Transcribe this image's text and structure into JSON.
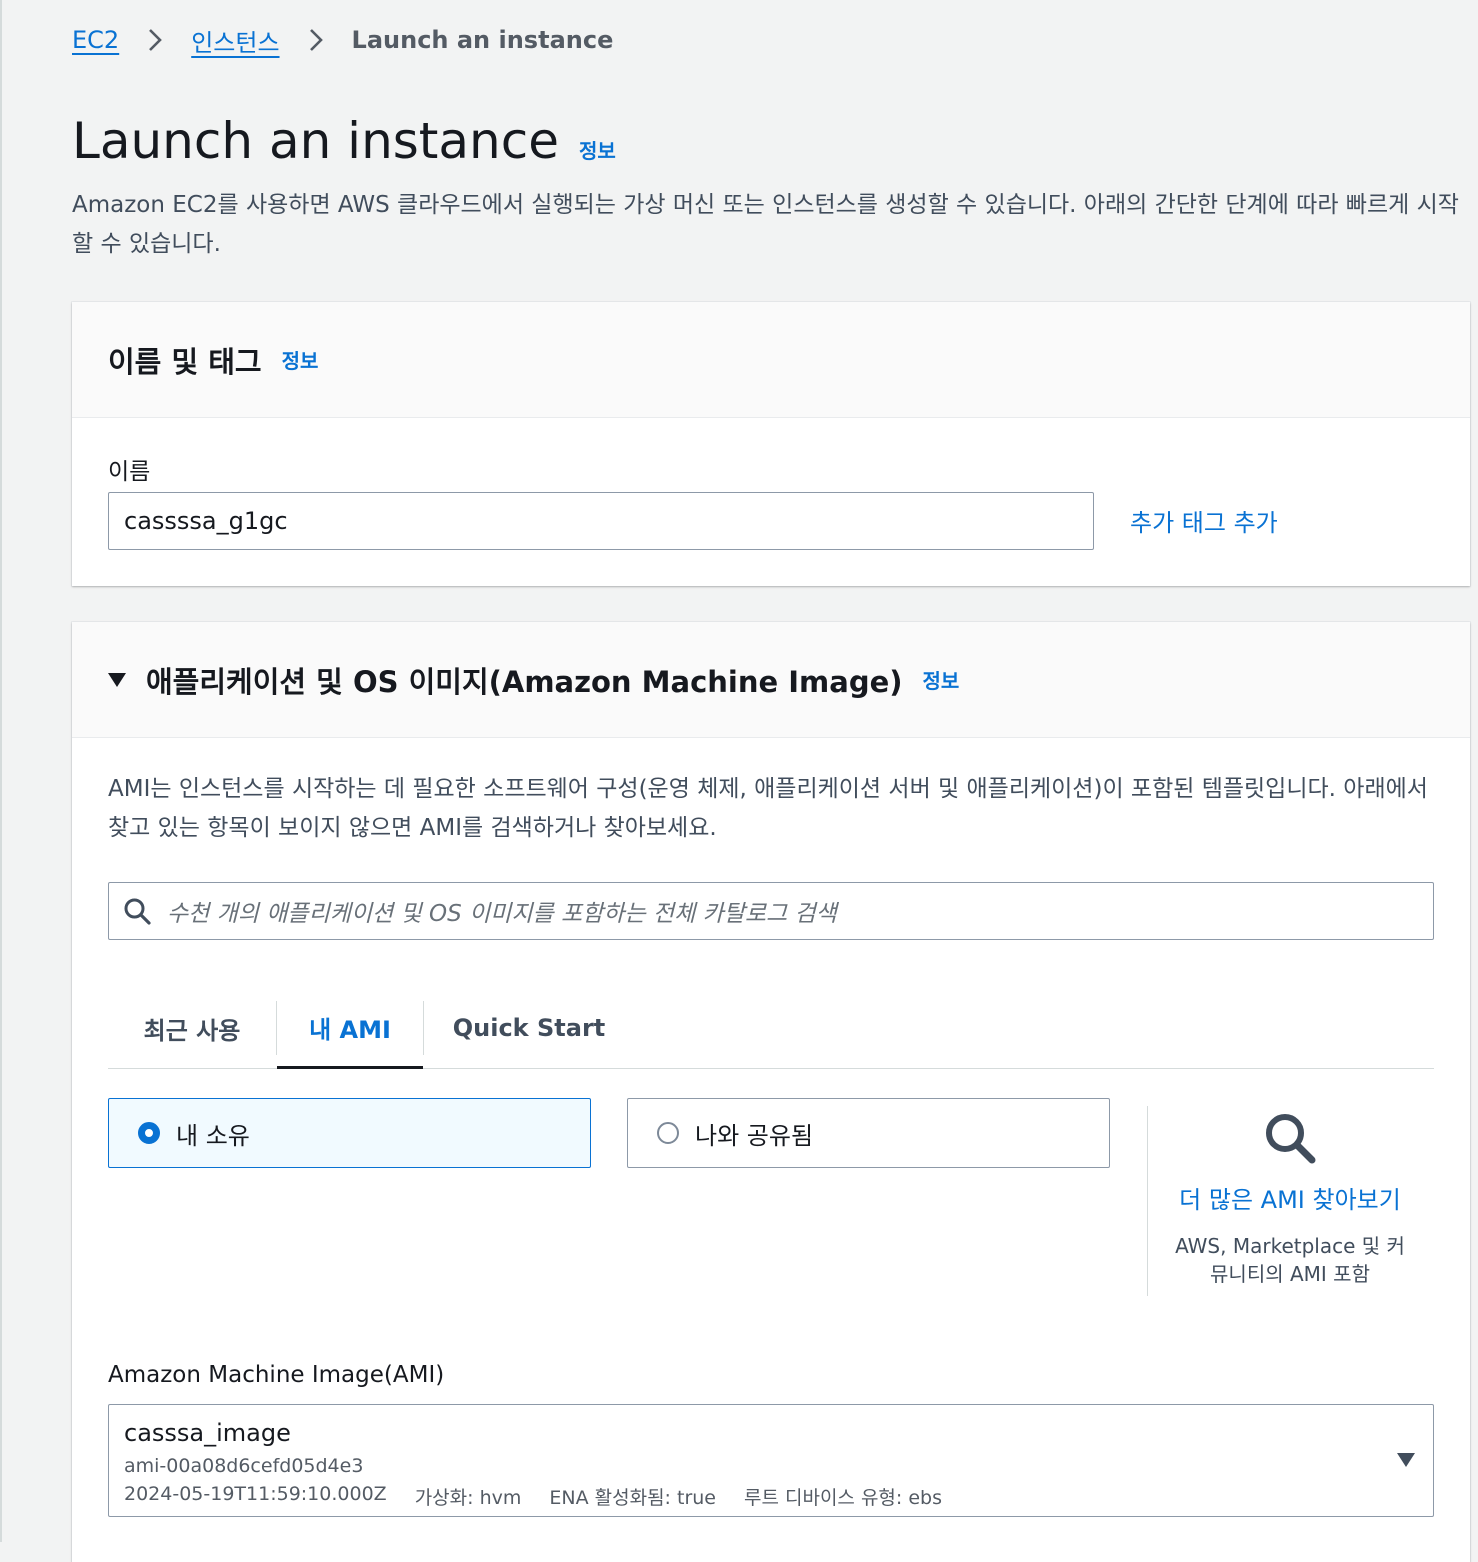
{
  "breadcrumb": {
    "items": [
      "EC2",
      "인스턴스"
    ],
    "current": "Launch an instance"
  },
  "page": {
    "title": "Launch an instance",
    "info": "정보",
    "description": "Amazon EC2를 사용하면 AWS 클라우드에서 실행되는 가상 머신 또는 인스턴스를 생성할 수 있습니다. 아래의 간단한 단계에 따라 빠르게 시작할 수 있습니다."
  },
  "name_tags": {
    "title": "이름 및 태그",
    "info": "정보",
    "name_label": "이름",
    "name_value": "cassssa_g1gc",
    "add_tags": "추가 태그 추가"
  },
  "ami_section": {
    "title": "애플리케이션 및 OS 이미지(Amazon Machine Image)",
    "info": "정보",
    "description": "AMI는 인스턴스를 시작하는 데 필요한 소프트웨어 구성(운영 체제, 애플리케이션 서버 및 애플리케이션)이 포함된 템플릿입니다. 아래에서 찾고 있는 항목이 보이지 않으면 AMI를 검색하거나 찾아보세요.",
    "search_placeholder": "수천 개의 애플리케이션 및 OS 이미지를 포함하는 전체 카탈로그 검색",
    "tabs": [
      "최근 사용",
      "내 AMI",
      "Quick Start"
    ],
    "active_tab": "내 AMI",
    "options": [
      {
        "label": "내 소유",
        "selected": true
      },
      {
        "label": "나와 공유됨",
        "selected": false
      }
    ],
    "browse_link": "더 많은 AMI 찾아보기",
    "browse_sub": "AWS, Marketplace 및 커뮤니티의 AMI 포함",
    "ami_label": "Amazon Machine Image(AMI)",
    "selected_ami": {
      "name": "casssa_image",
      "id": "ami-00a08d6cefd05d4e3",
      "created": "2024-05-19T11:59:10.000Z",
      "virtualization": "가상화: hvm",
      "ena": "ENA 활성화됨: true",
      "root_device": "루트 디바이스 유형: ebs"
    }
  },
  "colors": {
    "link": "#0972d3",
    "text": "#16191f",
    "background": "#f2f3f3"
  }
}
